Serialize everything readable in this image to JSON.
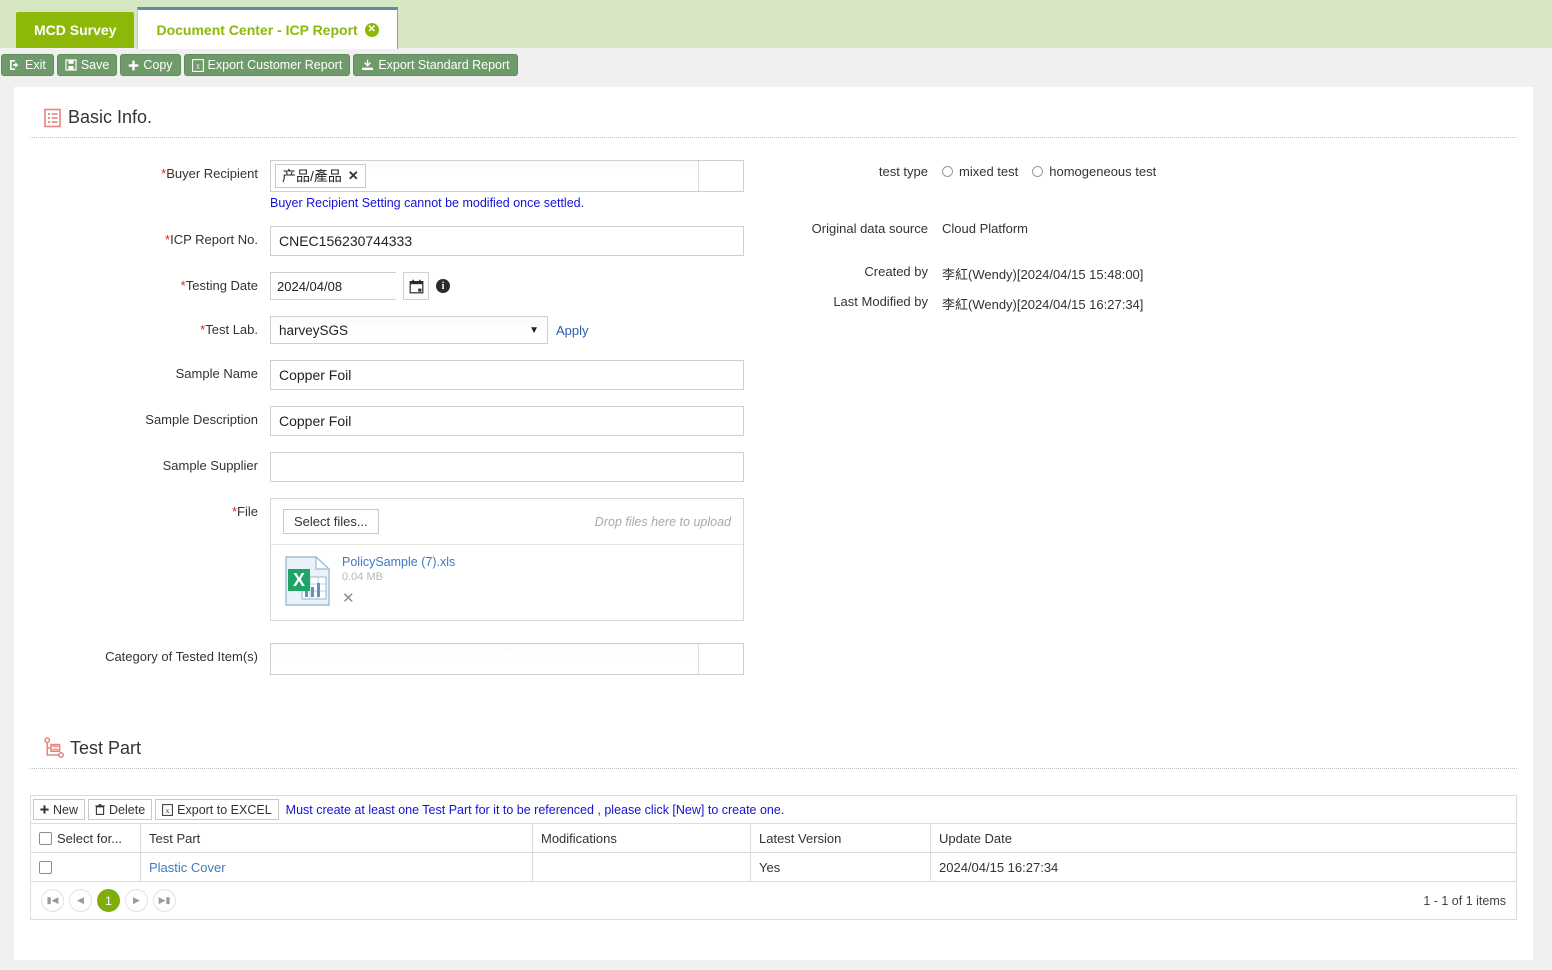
{
  "tabs": [
    {
      "label": "MCD Survey",
      "active": false,
      "closable": false
    },
    {
      "label": "Document Center - ICP Report",
      "active": true,
      "closable": true,
      "close_icon": "close-circle-icon"
    }
  ],
  "toolbar": {
    "buttons": [
      {
        "label": "Exit",
        "icon": "exit-icon"
      },
      {
        "label": "Save",
        "icon": "floppy-disk-icon"
      },
      {
        "label": "Copy",
        "icon": "plus-icon"
      },
      {
        "label": "Export Customer Report",
        "icon": "excel-icon"
      },
      {
        "label": "Export Standard Report",
        "icon": "download-icon"
      }
    ],
    "button_color": "#6f9a6a"
  },
  "sections": {
    "basic_info": {
      "title": "Basic Info.",
      "icon": "list-document-icon",
      "icon_color": "#e8837d"
    },
    "test_part": {
      "title": "Test Part",
      "icon": "hierarchy-tree-icon",
      "icon_color": "#e8837d"
    }
  },
  "form": {
    "buyer_recipient": {
      "label": "Buyer Recipient",
      "required": true,
      "tokens": [
        {
          "text": "产品/產品",
          "remove_icon": "x-icon"
        }
      ],
      "hint": "Buyer Recipient Setting cannot be modified once settled.",
      "hint_color": "#1313d8"
    },
    "icp_report_no": {
      "label": "ICP Report No.",
      "required": true,
      "value": "CNEC156230744333",
      "placeholder": ""
    },
    "testing_date": {
      "label": "Testing Date",
      "required": true,
      "value": "2024/04/08",
      "placeholder": "",
      "calendar_icon": "calendar-icon",
      "info_icon": "info-icon"
    },
    "test_lab": {
      "label": "Test Lab.",
      "required": true,
      "selected": "harveySGS",
      "caret_icon": "chevron-down-icon",
      "apply_link": "Apply"
    },
    "sample_name": {
      "label": "Sample Name",
      "required": false,
      "value": "Copper Foil",
      "placeholder": ""
    },
    "sample_description": {
      "label": "Sample Description",
      "required": false,
      "value": "Copper Foil",
      "placeholder": ""
    },
    "sample_supplier": {
      "label": "Sample Supplier",
      "required": false,
      "value": "",
      "placeholder": ""
    },
    "file": {
      "label": "File",
      "required": true,
      "select_button": "Select files...",
      "drop_hint": "Drop files here to upload",
      "files": [
        {
          "name": "PolicySample (7).xls",
          "size": "0.04 MB",
          "icon": "excel-file-icon",
          "remove_icon": "x-icon"
        }
      ]
    },
    "category_of_tested_items": {
      "label": "Category of Tested Item(s)",
      "required": false,
      "value": "",
      "placeholder": ""
    }
  },
  "meta": {
    "test_type": {
      "label": "test type",
      "options": [
        {
          "label": "mixed test",
          "selected": false
        },
        {
          "label": "homogeneous test",
          "selected": false
        }
      ]
    },
    "original_data_source": {
      "label": "Original data source",
      "value": "Cloud Platform"
    },
    "created_by": {
      "label": "Created by",
      "value": "李紅(Wendy)[2024/04/15 15:48:00]"
    },
    "last_modified_by": {
      "label": "Last Modified by",
      "value": "李紅(Wendy)[2024/04/15 16:27:34]"
    }
  },
  "test_part_grid": {
    "toolbar": {
      "buttons": [
        {
          "label": "New",
          "icon": "plus-icon"
        },
        {
          "label": "Delete",
          "icon": "trash-icon"
        },
        {
          "label": "Export to EXCEL",
          "icon": "excel-icon"
        }
      ],
      "warning": "Must create at least one Test Part for it to be referenced , please click [New] to create one.",
      "warning_color": "#1313d8"
    },
    "columns": [
      "Select for...",
      "Test Part",
      "Modifications",
      "Latest Version",
      "Update Date"
    ],
    "rows": [
      {
        "selected": false,
        "test_part": "Plastic Cover",
        "modifications": "",
        "latest_version": "Yes",
        "update_date": "2024/04/15 16:27:34"
      }
    ],
    "pager": {
      "first_icon": "first-page-icon",
      "prev_icon": "prev-page-icon",
      "pages": [
        "1"
      ],
      "current_page": "1",
      "next_icon": "next-page-icon",
      "last_icon": "last-page-icon",
      "info": "1 - 1 of 1 items",
      "active_color": "#7fae0a"
    }
  }
}
